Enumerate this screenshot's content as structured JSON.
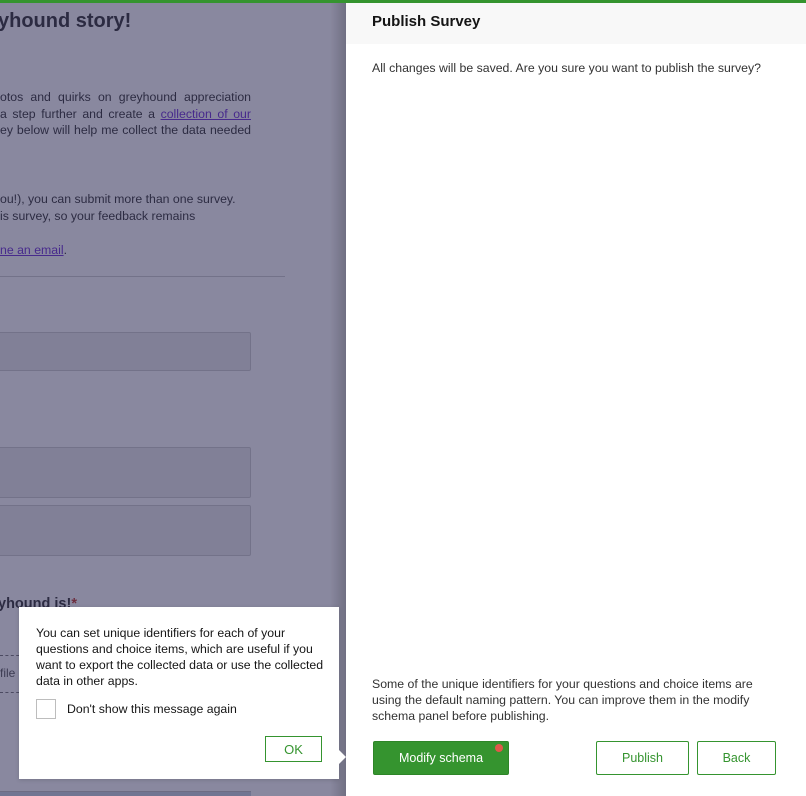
{
  "background_form": {
    "title": "yhound story!",
    "intro": {
      "line1": "otos and quirks on greyhound appreciation",
      "line2_prefix": "a step further and create a ",
      "line2_link": "collection of our",
      "line3": "ey below will help me collect the data needed"
    },
    "info": {
      "line1": "ou!), you can submit more than one survey.",
      "line2": "is survey, so your feedback remains",
      "email_link": "ne an email",
      "email_suffix": "."
    },
    "question_label": "yhound is!",
    "required_marker": "*",
    "file_hint": "file"
  },
  "panel": {
    "title": "Publish Survey",
    "message": "All changes will be saved. Are you sure you want to publish the survey?",
    "note": "Some of the unique identifiers for your questions and choice items are using the default naming pattern. You can improve them in the modify schema panel before publishing.",
    "buttons": {
      "modify_schema": "Modify schema",
      "publish": "Publish",
      "back": "Back"
    },
    "colors": {
      "accent": "#35942f",
      "notification_dot": "#e0584a"
    }
  },
  "popover": {
    "text": "You can set unique identifiers for each of your questions and choice items, which are useful if you want to export the collected data or use the collected data in other apps.",
    "checkbox_label": "Don't show this message again",
    "checkbox_checked": false,
    "ok_label": "OK"
  }
}
